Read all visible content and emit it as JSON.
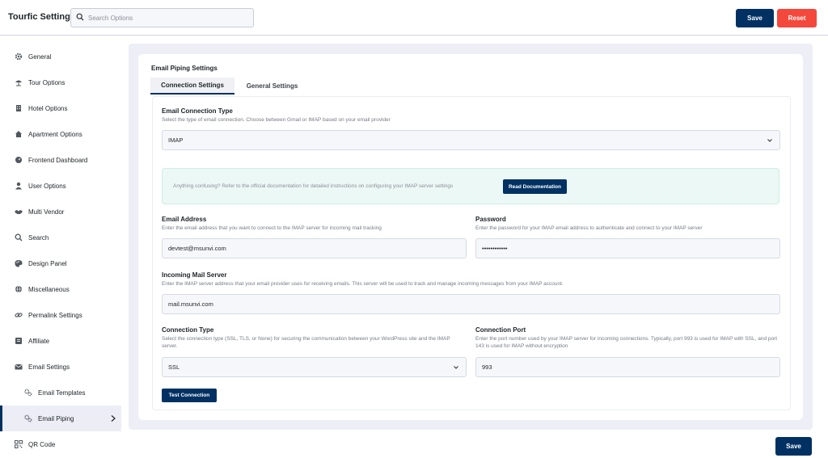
{
  "header": {
    "title": "Tourfic Settings",
    "search_placeholder": "Search Options",
    "save_label": "Save",
    "reset_label": "Reset"
  },
  "sidebar": {
    "items": [
      {
        "label": "General",
        "icon": "gear-icon"
      },
      {
        "label": "Tour Options",
        "icon": "umbrella-icon"
      },
      {
        "label": "Hotel Options",
        "icon": "building-icon"
      },
      {
        "label": "Apartment Options",
        "icon": "house-icon"
      },
      {
        "label": "Frontend Dashboard",
        "icon": "dashboard-icon"
      },
      {
        "label": "User Options",
        "icon": "user-icon"
      },
      {
        "label": "Multi Vendor",
        "icon": "handshake-icon"
      },
      {
        "label": "Search",
        "icon": "search-icon"
      },
      {
        "label": "Design Panel",
        "icon": "palette-icon"
      },
      {
        "label": "Miscellaneous",
        "icon": "globe-icon"
      },
      {
        "label": "Permalink Settings",
        "icon": "link-icon"
      },
      {
        "label": "Affiliate",
        "icon": "affiliate-icon"
      },
      {
        "label": "Email Settings",
        "icon": "envelope-icon"
      },
      {
        "label": "Email Templates",
        "icon": "gears-icon"
      },
      {
        "label": "Email Piping",
        "icon": "gears-icon"
      },
      {
        "label": "QR Code",
        "icon": "qr-code-icon"
      }
    ]
  },
  "panel": {
    "title": "Email Piping Settings",
    "tabs": [
      "Connection Settings",
      "General Settings"
    ],
    "connection_type": {
      "label": "Email Connection Type",
      "hint": "Select the type of email connection. Choose between Gmail or IMAP based on your email provider",
      "value": "IMAP"
    },
    "notice": {
      "text": "Anything confusing? Refer to the official documentation for detailed instructions on configuring your IMAP server settings",
      "button": "Read Documentation"
    },
    "email": {
      "label": "Email Address",
      "hint": "Enter the email address that you want to connect to the IMAP server for incoming mail tracking",
      "value": "devtest@msunvi.com"
    },
    "password": {
      "label": "Password",
      "hint": "Enter the password for your IMAP email address to authenticate and connect to your IMAP server",
      "value": "••••••••••••"
    },
    "server": {
      "label": "Incoming Mail Server",
      "hint": "Enter the IMAP server address that your email provider uses for receiving emails. This server will be used to track and manage incoming messages from your IMAP account.",
      "value": "mail.msunvi.com"
    },
    "conn_type": {
      "label": "Connection Type",
      "hint": "Select the connection type (SSL, TLS, or None) for securing the communication between your WordPress site and the IMAP server.",
      "value": "SSL"
    },
    "port": {
      "label": "Connection Port",
      "hint": "Enter the port number used by your IMAP server for incoming connections. Typically, port 993 is used for IMAP with SSL, and port 143 is used for IMAP without encryption",
      "value": "993"
    },
    "test_button": "Test Connection"
  },
  "footer": {
    "save_label": "Save"
  }
}
